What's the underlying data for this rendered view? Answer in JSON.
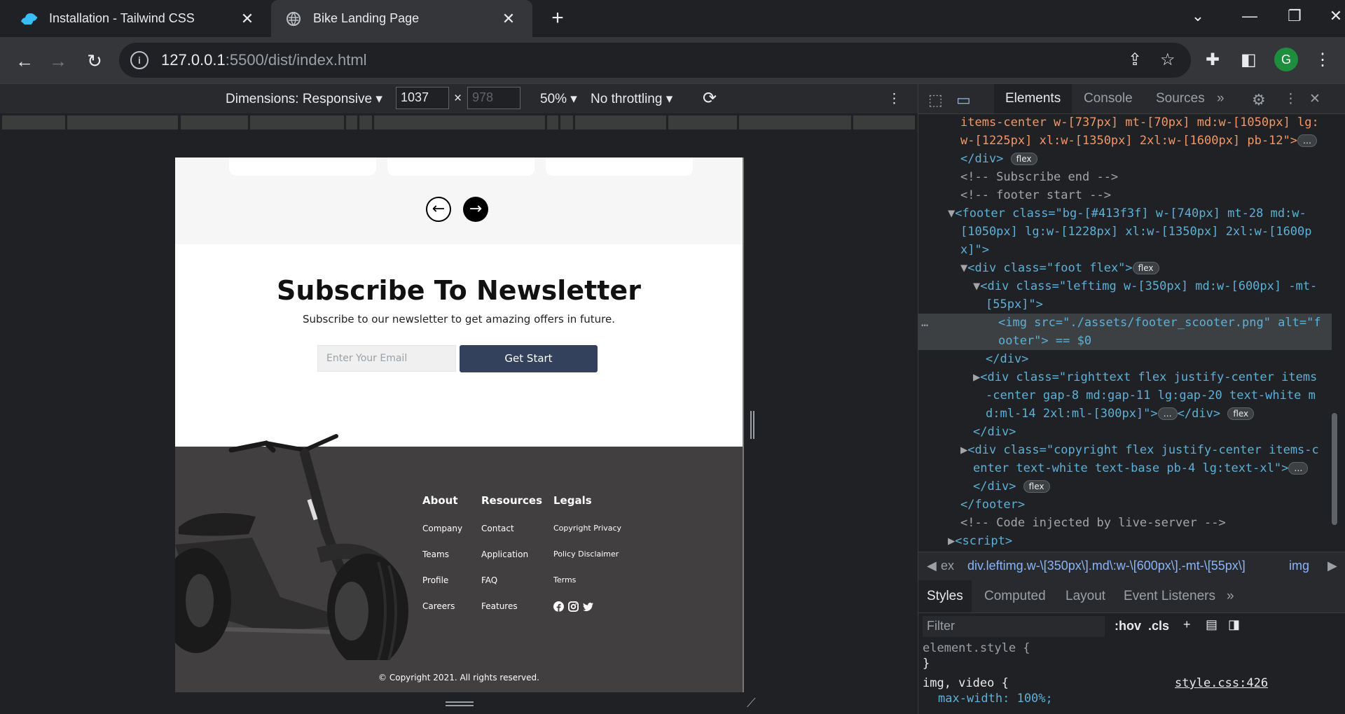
{
  "tabs": [
    {
      "title": "Installation - Tailwind CSS",
      "active": false
    },
    {
      "title": "Bike Landing Page",
      "active": true
    }
  ],
  "address": {
    "host": "127.0.0.1",
    "rest": ":5500/dist/index.html"
  },
  "avatar_letter": "G",
  "device_toolbar": {
    "dimensions": "Dimensions: Responsive",
    "width": "1037",
    "height_placeholder": "978",
    "times": "×",
    "zoom": "50%",
    "throttling": "No throttling"
  },
  "page": {
    "subscribe_title": "Subscribe To Newsletter",
    "subscribe_desc": "Subscribe to our newsletter to get amazing offers in future.",
    "email_placeholder": "Enter Your Email",
    "button_label": "Get Start",
    "footer": {
      "columns": [
        {
          "title": "About",
          "items": [
            "Company",
            "Teams",
            "Profile",
            "Careers"
          ]
        },
        {
          "title": "Resources",
          "items": [
            "Contact",
            "Application",
            "FAQ",
            "Features"
          ]
        },
        {
          "title": "Legals",
          "items": [
            "Copyright Privacy",
            "Policy Disclaimer",
            "Terms"
          ]
        }
      ],
      "social_icons": [
        "facebook-icon",
        "instagram-icon",
        "twitter-icon"
      ],
      "copyright": "© Copyright 2021. All rights reserved."
    },
    "colors": {
      "footer_bg": "#413f3f",
      "button_bg": "#33415c",
      "carousel_bg": "#f6f6f6"
    }
  },
  "devtools": {
    "tabs": [
      "Elements",
      "Console",
      "Sources"
    ],
    "code": [
      "items-center w-[737px] mt-[70px] md:w-[1050px] lg:",
      "w-[1225px] xl:w-[1350px] 2xl:w-[1600px] pb-12\">",
      "</div>",
      "<!-- Subscribe end -->",
      "<!-- footer start -->",
      "<footer class=\"bg-[#413f3f] w-[740px] mt-28 md:w-",
      "[1050px] lg:w-[1228px] xl:w-[1350px] 2xl:w-[1600p",
      "x]\">",
      "<div class=\"foot flex\">",
      "<div class=\"leftimg w-[350px] md:w-[600px] -mt-",
      "[55px]\">",
      "<img src=\"./assets/footer_scooter.png\" alt=\"f",
      "ooter\"> == $0",
      "</div>",
      "<div class=\"righttext flex justify-center items",
      "-center gap-8 md:gap-11 lg:gap-20 text-white m",
      "d:ml-14 2xl:ml-[300px]\">",
      "</div>",
      "<div class=\"copyright flex justify-center items-c",
      "enter text-white text-base pb-4 lg:text-xl\">",
      "</div>",
      "</footer>",
      "<!-- Code injected by live-server -->",
      "<script>"
    ],
    "pill_flex": "flex",
    "breadcrumb": "div.leftimg.w-\\[350px\\].md\\:w-\\[600px\\].-mt-\\[55px\\]",
    "breadcrumb_prefix": "ex",
    "breadcrumb_tail": "img",
    "styles_tabs": [
      "Styles",
      "Computed",
      "Layout",
      "Event Listeners"
    ],
    "filter_placeholder": "Filter",
    "hov": ":hov",
    "cls": ".cls",
    "styles": {
      "element_style": "element.style {",
      "close": "}",
      "selector": "img, video {",
      "source": "style.css:426",
      "prop": "max-width: 100%;"
    }
  }
}
